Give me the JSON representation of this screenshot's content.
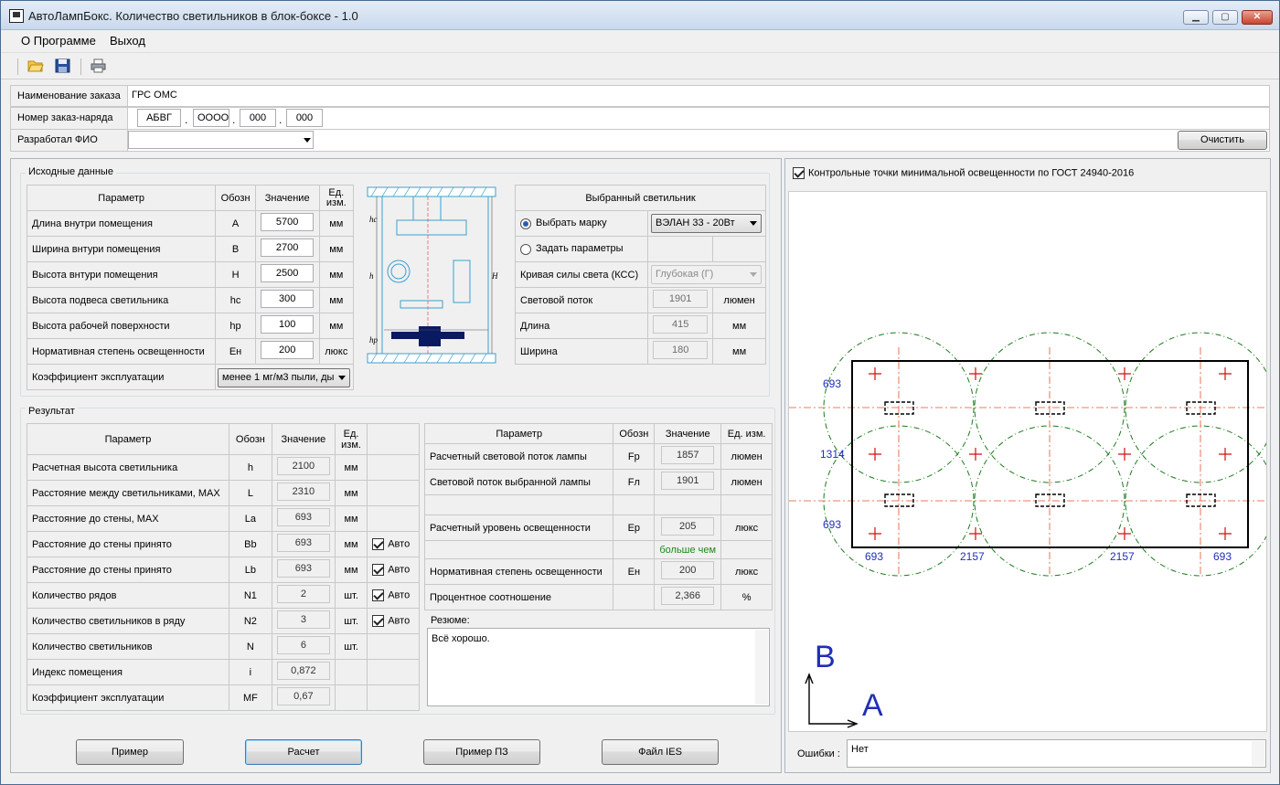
{
  "window": {
    "title": "АвтоЛампБокс. Количество светильников в блок-боксе - 1.0",
    "controls": {
      "minimize": "▁",
      "maximize": "▢",
      "close": "✕"
    }
  },
  "menu": {
    "about": "О Программе",
    "exit": "Выход"
  },
  "toolbar": {
    "icons": [
      "open-folder-icon",
      "save-icon",
      "print-icon"
    ]
  },
  "order": {
    "name_label": "Наименование заказа",
    "name_value": "ГРС ОМС",
    "number_label": "Номер заказ-наряда",
    "number_parts": [
      "АБВГ",
      "ОООО",
      "000",
      "000"
    ],
    "number_sep": ".",
    "author_label": "Разработал ФИО",
    "author_value": "",
    "clear_button": "Очистить"
  },
  "source": {
    "title": "Исходные данные",
    "headers": {
      "param": "Параметр",
      "sym": "Обозн",
      "value": "Значение",
      "unit": "Ед. изм."
    },
    "rows": [
      {
        "param": "Длина внутри помещения",
        "sym": "A",
        "value": "5700",
        "unit": "мм"
      },
      {
        "param": "Ширина внтури помещения",
        "sym": "B",
        "value": "2700",
        "unit": "мм"
      },
      {
        "param": "Высота внтури помещения",
        "sym": "H",
        "value": "2500",
        "unit": "мм"
      },
      {
        "param": "Высота подвеса светильника",
        "sym": "hc",
        "value": "300",
        "unit": "мм"
      },
      {
        "param": "Высота рабочей поверхности",
        "sym": "hp",
        "value": "100",
        "unit": "мм"
      },
      {
        "param": "Нормативная степень освещенности",
        "sym": "Eн",
        "value": "200",
        "unit": "люкс"
      }
    ],
    "maint_label": "Коэффициент эксплуатации",
    "maint_value": "менее 1 мг/м3 пыли, ды",
    "sketch_labels": {
      "hc": "hc",
      "h": "h",
      "hp": "hp",
      "H": "H"
    }
  },
  "lamp": {
    "title": "Выбранный светильник",
    "choose_brand": "Выбрать марку",
    "brand_value": "ВЭЛАН 33 - 20Вт",
    "set_params": "Задать параметры",
    "curve_label": "Кривая силы света (КСС)",
    "curve_value": "Глубокая (Г)",
    "flux_label": "Световой поток",
    "flux_value": "1901",
    "flux_unit": "люмен",
    "length_label": "Длина",
    "length_value": "415",
    "length_unit": "мм",
    "width_label": "Ширина",
    "width_value": "180",
    "width_unit": "мм"
  },
  "result": {
    "title": "Рeзультат",
    "headers": {
      "param": "Параметр",
      "sym": "Обозн",
      "value": "Значение",
      "unit": "Ед. изм."
    },
    "rows": [
      {
        "param": "Расчетная высота светильника",
        "sym": "h",
        "value": "2100",
        "unit": "мм",
        "auto": ""
      },
      {
        "param": "Расстояние между светильниками, MAX",
        "sym": "L",
        "value": "2310",
        "unit": "мм",
        "auto": ""
      },
      {
        "param": "Расстояние до стены, MAX",
        "sym": "La",
        "value": "693",
        "unit": "мм",
        "auto": ""
      },
      {
        "param": "Расстояние до стены принято",
        "sym": "Bb",
        "value": "693",
        "unit": "мм",
        "auto": "Авто"
      },
      {
        "param": "Расстояние до стены принято",
        "sym": "Lb",
        "value": "693",
        "unit": "мм",
        "auto": "Авто"
      },
      {
        "param": "Количество рядов",
        "sym": "N1",
        "value": "2",
        "unit": "шт.",
        "auto": "Авто"
      },
      {
        "param": "Количество светильников в ряду",
        "sym": "N2",
        "value": "3",
        "unit": "шт.",
        "auto": "Авто"
      },
      {
        "param": "Количество светильников",
        "sym": "N",
        "value": "6",
        "unit": "шт.",
        "auto": ""
      },
      {
        "param": "Индекс помещения",
        "sym": "i",
        "value": "0,872",
        "unit": "",
        "auto": ""
      },
      {
        "param": "Коэффициент эксплуатации",
        "sym": "MF",
        "value": "0,67",
        "unit": "",
        "auto": ""
      }
    ],
    "right_headers": {
      "param": "Параметр",
      "sym": "Обозн",
      "value": "Значение",
      "unit": "Ед. изм."
    },
    "right_rows": {
      "fp": {
        "param": "Расчетный световой поток лампы",
        "sym": "Fp",
        "value": "1857",
        "unit": "люмен"
      },
      "fl": {
        "param": "Световой поток выбранной лампы",
        "sym": "Fл",
        "value": "1901",
        "unit": "люмен"
      },
      "ep": {
        "param": "Расчетный уровень освещенности",
        "sym": "Ep",
        "value": "205",
        "unit": "люкс"
      },
      "compare": "больше чем",
      "en": {
        "param": "Нормативная степень освещенности",
        "sym": "Eн",
        "value": "200",
        "unit": "люкс"
      },
      "pct": {
        "param": "Процентное соотношение",
        "sym": "",
        "value": "2,366",
        "unit": "%"
      }
    },
    "summary_label": "Резюме:",
    "summary_text": "Всё хорошо."
  },
  "buttons": {
    "example": "Пример",
    "calc": "Расчет",
    "example_pz": "Пример ПЗ",
    "ies": "Файл IES"
  },
  "plan": {
    "checkbox_label": "Контрольные точки минимальной освещенности по ГОСТ 24940-2016",
    "dims_left": [
      "693",
      "1314",
      "693"
    ],
    "dims_bottom": [
      "693",
      "2157",
      "2157",
      "693"
    ],
    "axis_b": "B",
    "axis_a": "A",
    "colors": {
      "circle": "#1d7a1d",
      "axis": "#e8502a",
      "cross": "#d01010",
      "dim": "#1f2fb8",
      "frame": "#000000"
    }
  },
  "errors": {
    "label": "Ошибки :",
    "value": "Нет"
  }
}
